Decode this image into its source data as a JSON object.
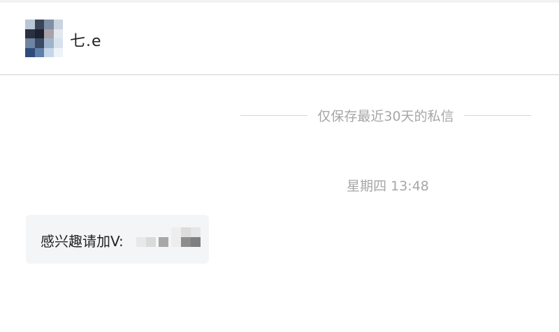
{
  "header": {
    "contact_name": "七.e",
    "avatar_icon": "blurred-avatar-icon"
  },
  "chat": {
    "retention_notice": "仅保存最近30天的私信",
    "timestamp": "星期四 13:48",
    "messages": [
      {
        "side": "left",
        "text": "感兴趣请加V:"
      }
    ]
  },
  "colors": {
    "background": "#ffffff",
    "divider": "#e6e6e6",
    "muted_text": "#a6a6a6",
    "bubble": "#f4f5f6",
    "text": "#222222"
  }
}
